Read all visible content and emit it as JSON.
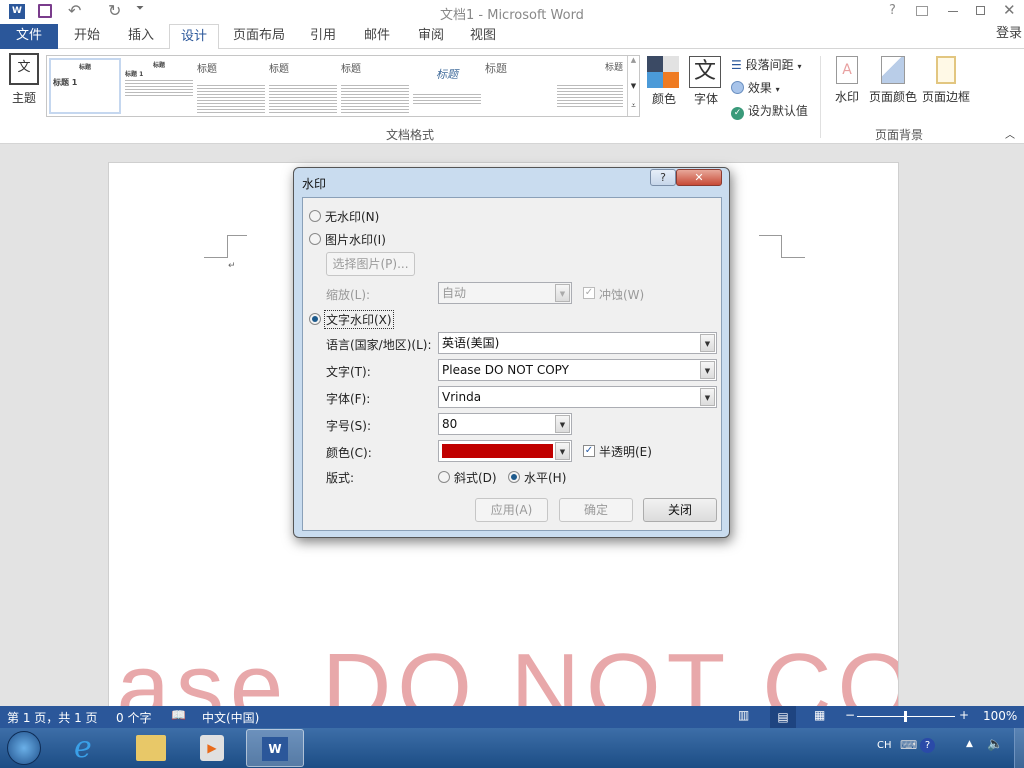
{
  "titlebar": {
    "title": "文档1 - Microsoft Word",
    "help": "?",
    "signin": "登录"
  },
  "tabs": [
    "文件",
    "开始",
    "插入",
    "设计",
    "页面布局",
    "引用",
    "邮件",
    "审阅",
    "视图"
  ],
  "ribbon": {
    "theme": "主题",
    "gallery_heading": "标题",
    "gallery_h1": "标题 1",
    "group_docformat": "文档格式",
    "colors": "颜色",
    "fonts": "字体",
    "font_glyph": "文",
    "para_spacing": "段落间距",
    "effects": "效果",
    "set_default": "设为默认值",
    "watermark": "水印",
    "page_color": "页面颜色",
    "page_borders": "页面边框",
    "group_background": "页面背景"
  },
  "document": {
    "watermark_text": "Please DO NOT COPY"
  },
  "dialog": {
    "title": "水印",
    "no_watermark": "无水印(N)",
    "picture_watermark": "图片水印(I)",
    "select_picture": "选择图片(P)...",
    "scale_label": "缩放(L):",
    "scale_value": "自动",
    "washout": "冲蚀(W)",
    "text_watermark": "文字水印(X)",
    "language_label": "语言(国家/地区)(L):",
    "language_value": "英语(美国)",
    "text_label": "文字(T):",
    "text_value": "Please DO NOT COPY",
    "font_label": "字体(F):",
    "font_value": "Vrinda",
    "size_label": "字号(S):",
    "size_value": "80",
    "color_label": "颜色(C):",
    "color_value": "#c00000",
    "semitransparent": "半透明(E)",
    "layout_label": "版式:",
    "diagonal": "斜式(D)",
    "horizontal": "水平(H)",
    "apply": "应用(A)",
    "ok": "确定",
    "close": "关闭"
  },
  "status": {
    "page": "第 1 页，共 1 页",
    "words": "0 个字",
    "language": "中文(中国)",
    "zoom": "100%",
    "zoom_value": 100
  },
  "taskbar": {
    "ime": "CH"
  }
}
